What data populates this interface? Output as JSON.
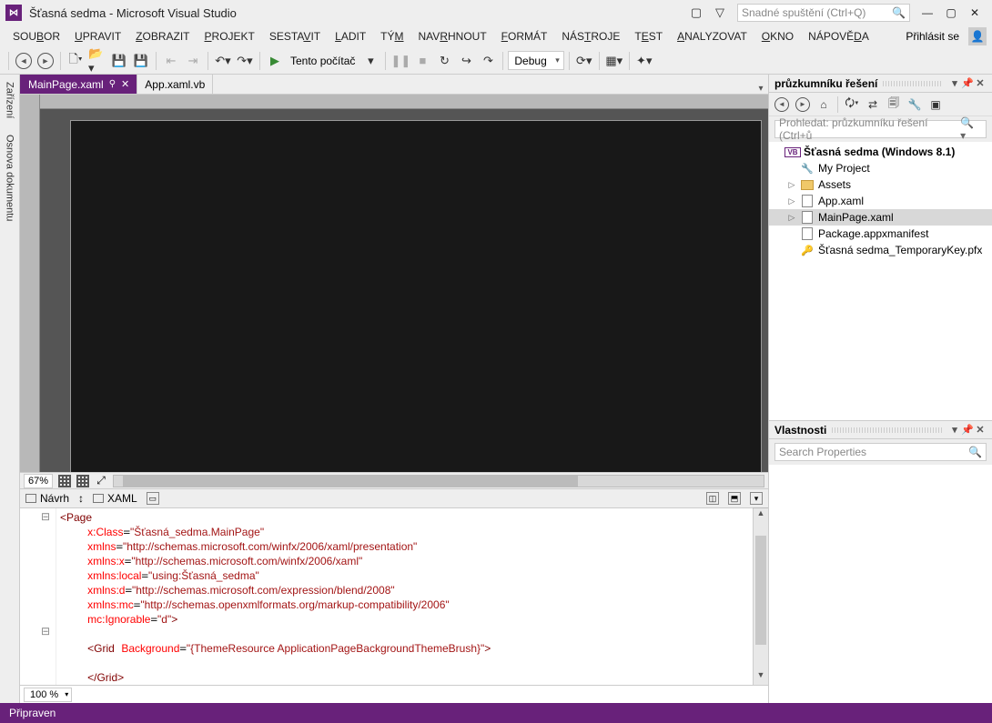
{
  "title": "Šťasná sedma - Microsoft Visual Studio",
  "quicklaunch_placeholder": "Snadné spuštění (Ctrl+Q)",
  "login": "Přihlásit se",
  "menu": [
    "SOUBOR",
    "UPRAVIT",
    "ZOBRAZIT",
    "PROJEKT",
    "SESTAVIT",
    "LADIT",
    "TÝM",
    "NAVRHNOUT",
    "FORMÁT",
    "NÁSTROJE",
    "TEST",
    "ANALYZOVAT",
    "OKNO",
    "NÁPOVĚDA"
  ],
  "menu_ul": [
    3,
    0,
    0,
    0,
    5,
    0,
    2,
    3,
    0,
    3,
    0,
    0,
    0,
    6
  ],
  "toolbar": {
    "target": "Tento počítač",
    "config": "Debug"
  },
  "tabs": {
    "active": "MainPage.xaml",
    "other": "App.xaml.vb"
  },
  "design_zoom": "67%",
  "split": {
    "design": "Návrh",
    "xaml": "XAML"
  },
  "code_lines": [
    "<Page",
    "    x:Class=\"Šťasná_sedma.MainPage\"",
    "    xmlns=\"http://schemas.microsoft.com/winfx/2006/xaml/presentation\"",
    "    xmlns:x=\"http://schemas.microsoft.com/winfx/2006/xaml\"",
    "    xmlns:local=\"using:Šťasná_sedma\"",
    "    xmlns:d=\"http://schemas.microsoft.com/expression/blend/2008\"",
    "    xmlns:mc=\"http://schemas.openxmlformats.org/markup-compatibility/2006\"",
    "    mc:Ignorable=\"d\">",
    "",
    "    <Grid Background=\"{ThemeResource ApplicationPageBackgroundThemeBrush}\">",
    "",
    "    </Grid>"
  ],
  "code_zoom": "100 %",
  "left_tabs": [
    "Zařízení",
    "Osnova dokumentu"
  ],
  "solution": {
    "title": "průzkumníku řešení",
    "search_placeholder": "Prohledat: průzkumníku řešení (Ctrl+ů",
    "root": "Šťasná sedma (Windows 8.1)",
    "items": [
      "My Project",
      "Assets",
      "App.xaml",
      "MainPage.xaml",
      "Package.appxmanifest",
      "Šťasná sedma_TemporaryKey.pfx"
    ]
  },
  "properties": {
    "title": "Vlastnosti",
    "search_placeholder": "Search Properties"
  },
  "status": "Připraven"
}
